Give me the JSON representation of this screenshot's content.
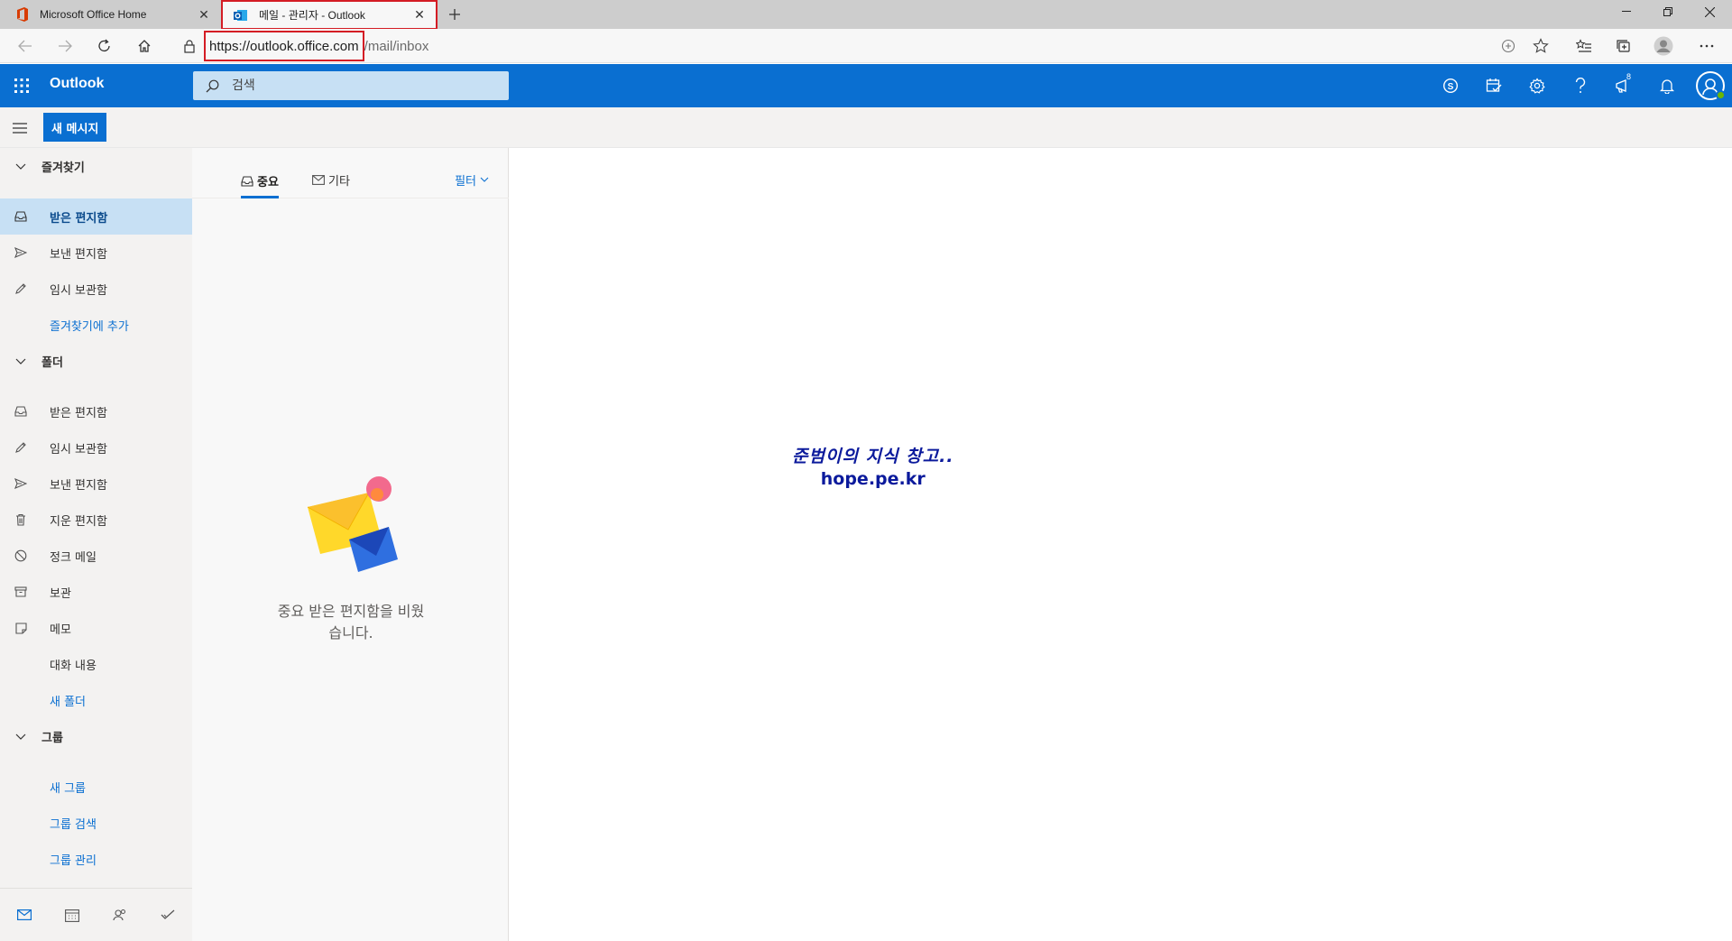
{
  "browser": {
    "tabs": [
      {
        "title": "Microsoft Office Home",
        "icon": "office-icon",
        "active": false
      },
      {
        "title": "메일 - 관리자 - Outlook",
        "icon": "outlook-icon",
        "active": true
      }
    ],
    "url_host": "https://outlook.office.com",
    "url_path": "/mail/inbox"
  },
  "header": {
    "app_name": "Outlook",
    "search_placeholder": "검색",
    "notification_badge": "8"
  },
  "command": {
    "new_message": "새 메시지"
  },
  "nav": {
    "favorites_title": "즐겨찾기",
    "favorites": [
      {
        "label": "받은 편지함",
        "icon": "inbox-icon",
        "selected": true
      },
      {
        "label": "보낸 편지함",
        "icon": "send-icon"
      },
      {
        "label": "임시 보관함",
        "icon": "pencil-icon"
      }
    ],
    "add_favorite": "즐겨찾기에 추가",
    "folders_title": "폴더",
    "folders": [
      {
        "label": "받은 편지함",
        "icon": "inbox-icon"
      },
      {
        "label": "임시 보관함",
        "icon": "pencil-icon"
      },
      {
        "label": "보낸 편지함",
        "icon": "send-icon"
      },
      {
        "label": "지운 편지함",
        "icon": "trash-icon"
      },
      {
        "label": "정크 메일",
        "icon": "block-icon"
      },
      {
        "label": "보관",
        "icon": "archive-icon"
      },
      {
        "label": "메모",
        "icon": "note-icon"
      },
      {
        "label": "대화 내용",
        "icon": ""
      }
    ],
    "new_folder": "새 폴더",
    "groups_title": "그룹",
    "groups": [
      "새 그룹",
      "그룹 검색",
      "그룹 관리"
    ]
  },
  "list": {
    "tab_focused": "중요",
    "tab_other": "기타",
    "filter": "필터",
    "empty_line1": "중요 받은 편지함을 비웠",
    "empty_line2": "습니다."
  },
  "reading": {
    "watermark_line1": "준범이의 지식 창고..",
    "watermark_line2": "hope.pe.kr"
  },
  "colors": {
    "brand": "#0a6fd1",
    "selected": "#c7e0f4",
    "highlight_box": "#d41c24"
  }
}
